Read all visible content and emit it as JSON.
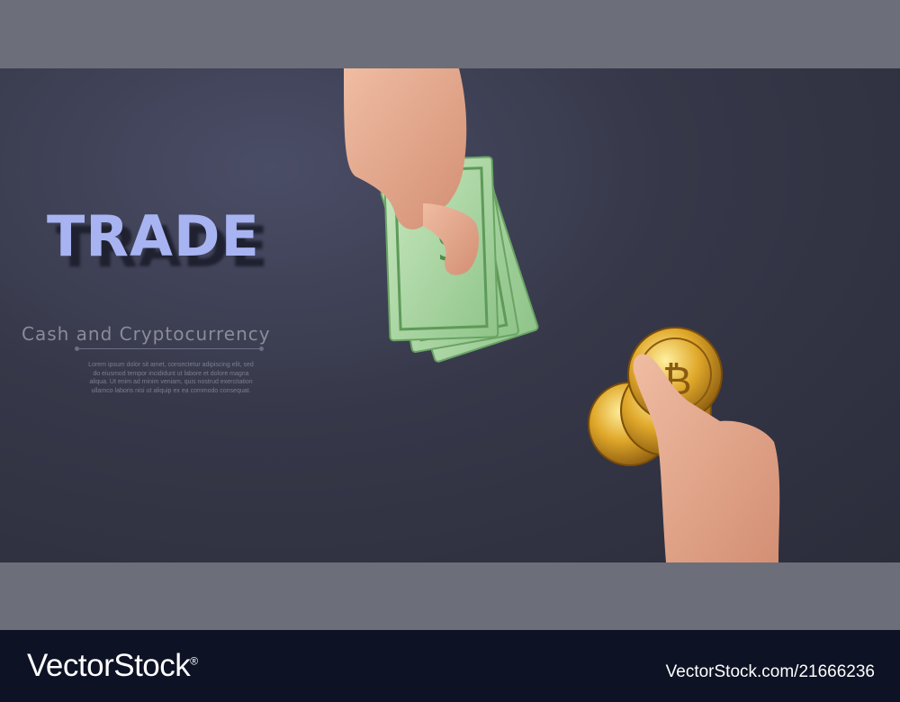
{
  "banner": {
    "title": "TRADE",
    "subtitle": "Cash and Cryptocurrency",
    "lorem": "Lorem ipsum dolor sit amet, consectetur adipiscing elit, sed do eiusmod tempor incididunt ut labore et dolore magna aliqua. Ut enim ad minim veniam, quis nostrud exercitation ullamco laboris nisi ut aliquip ex ea commodo consequat.",
    "coin_symbol": "₿"
  },
  "footer": {
    "logo": "VectorStock",
    "logo_mark": "®",
    "image_id": "VectorStock.com/21666236"
  },
  "colors": {
    "title": "#a8b4f2",
    "panel": "#2b2d3b",
    "band": "#6c6e79",
    "footer": "#0d1224",
    "banknote": "#9fcf98",
    "coin": "#d9a524",
    "skin": "#e2a68b"
  }
}
